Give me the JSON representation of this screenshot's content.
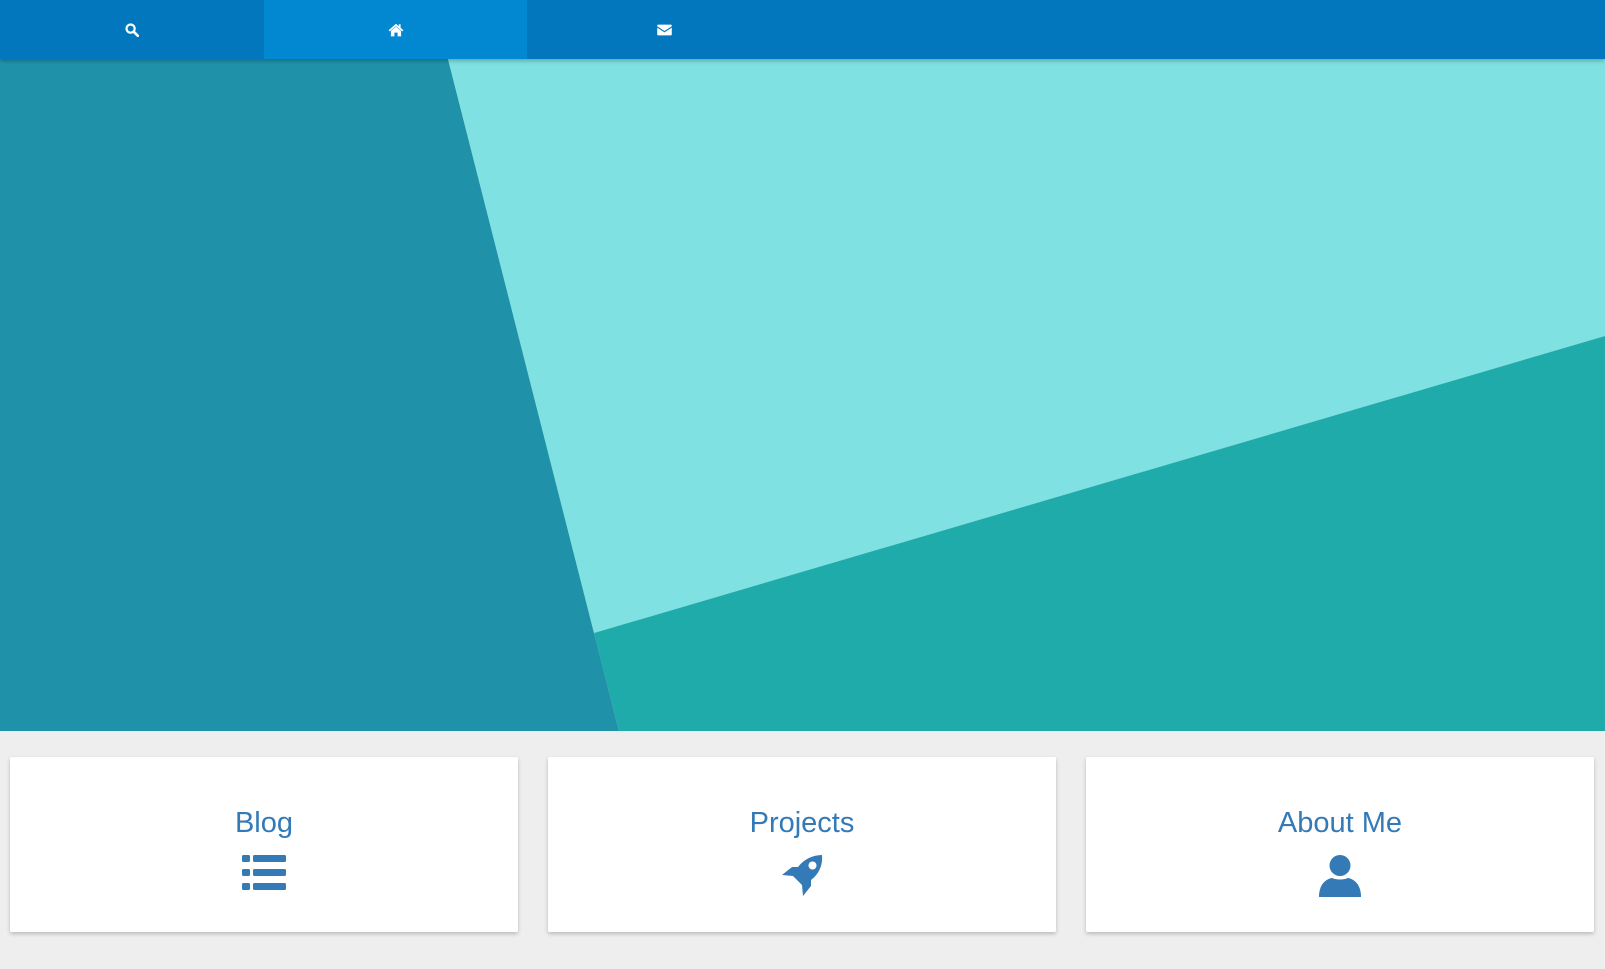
{
  "nav": {
    "items": [
      {
        "name": "search",
        "icon": "search-icon",
        "active": false
      },
      {
        "name": "home",
        "icon": "home-icon",
        "active": true
      },
      {
        "name": "mail",
        "icon": "envelope-icon",
        "active": false
      }
    ],
    "colors": {
      "bar": "#0277bd",
      "active": "#0288d1",
      "icon": "#ffffff"
    }
  },
  "hero": {
    "colors": [
      "#1f92aa",
      "#7fe1e1",
      "#20abab"
    ]
  },
  "cards": [
    {
      "title": "Blog",
      "icon": "list-icon"
    },
    {
      "title": "Projects",
      "icon": "rocket-icon"
    },
    {
      "title": "About Me",
      "icon": "user-icon"
    }
  ],
  "accent_color": "#337ab7"
}
